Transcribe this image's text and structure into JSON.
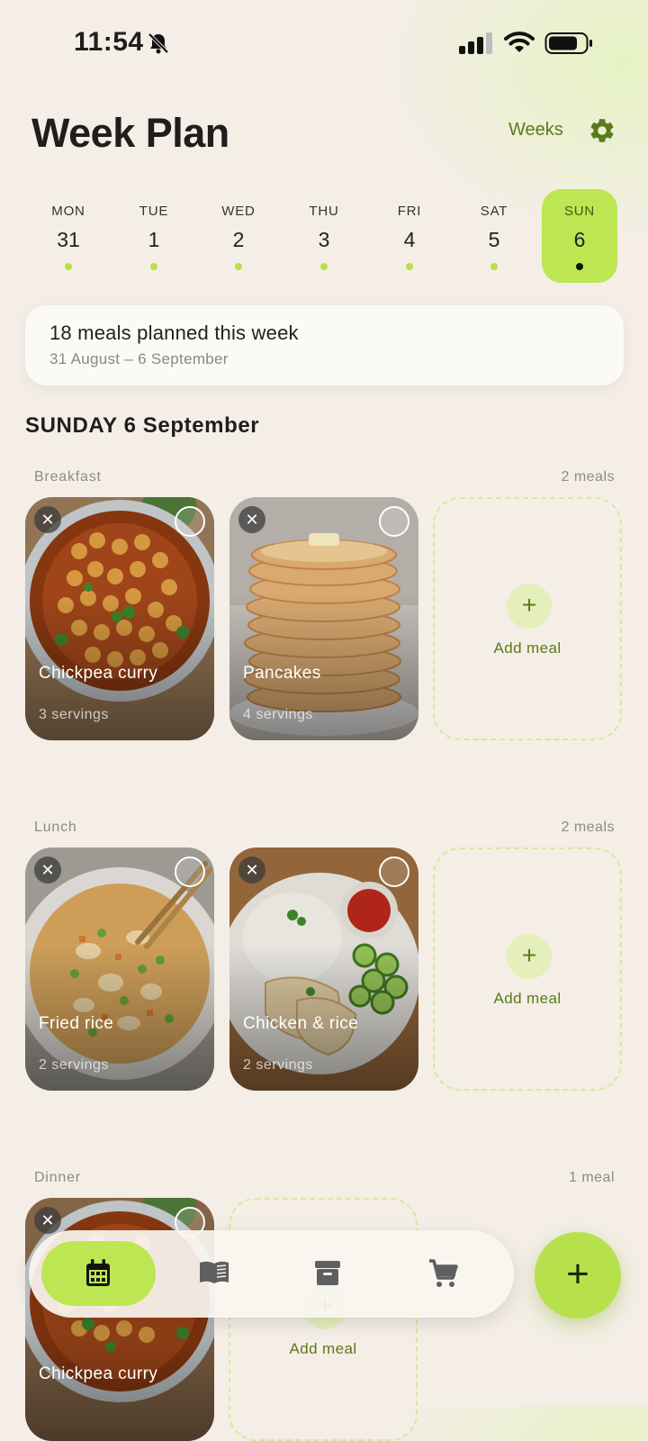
{
  "status_bar": {
    "time": "11:54"
  },
  "header": {
    "title": "Week Plan",
    "weeks_label": "Weeks"
  },
  "days": [
    {
      "name": "MON",
      "date": "31"
    },
    {
      "name": "TUE",
      "date": "1"
    },
    {
      "name": "WED",
      "date": "2"
    },
    {
      "name": "THU",
      "date": "3"
    },
    {
      "name": "FRI",
      "date": "4"
    },
    {
      "name": "SAT",
      "date": "5"
    },
    {
      "name": "SUN",
      "date": "6"
    }
  ],
  "summary": {
    "title": "18 meals planned this week",
    "range": "31 August – 6 September"
  },
  "section_title": "SUNDAY 6 September",
  "meals": [
    {
      "category": "Breakfast",
      "count": "2 meals",
      "items": [
        {
          "name": "Chickpea curry",
          "servings": "3 servings"
        },
        {
          "name": "Pancakes",
          "servings": "4 servings"
        }
      ],
      "add_label": "Add meal"
    },
    {
      "category": "Lunch",
      "count": "2 meals",
      "items": [
        {
          "name": "Fried rice",
          "servings": "2 servings"
        },
        {
          "name": "Chicken & rice",
          "servings": "2 servings"
        }
      ],
      "add_label": "Add meal"
    },
    {
      "category": "Dinner",
      "count": "1 meal",
      "items": [
        {
          "name": "Chickpea curry",
          "servings": ""
        }
      ],
      "add_label": "Add meal"
    }
  ],
  "nav": {
    "items": [
      "calendar-icon",
      "book-icon",
      "archive-icon",
      "cart-icon"
    ],
    "active": "calendar-icon"
  },
  "fab": {
    "label": "+"
  },
  "colors": {
    "accent": "#bde652",
    "accent_text": "#5a7a1e",
    "background": "#f4eee6"
  }
}
